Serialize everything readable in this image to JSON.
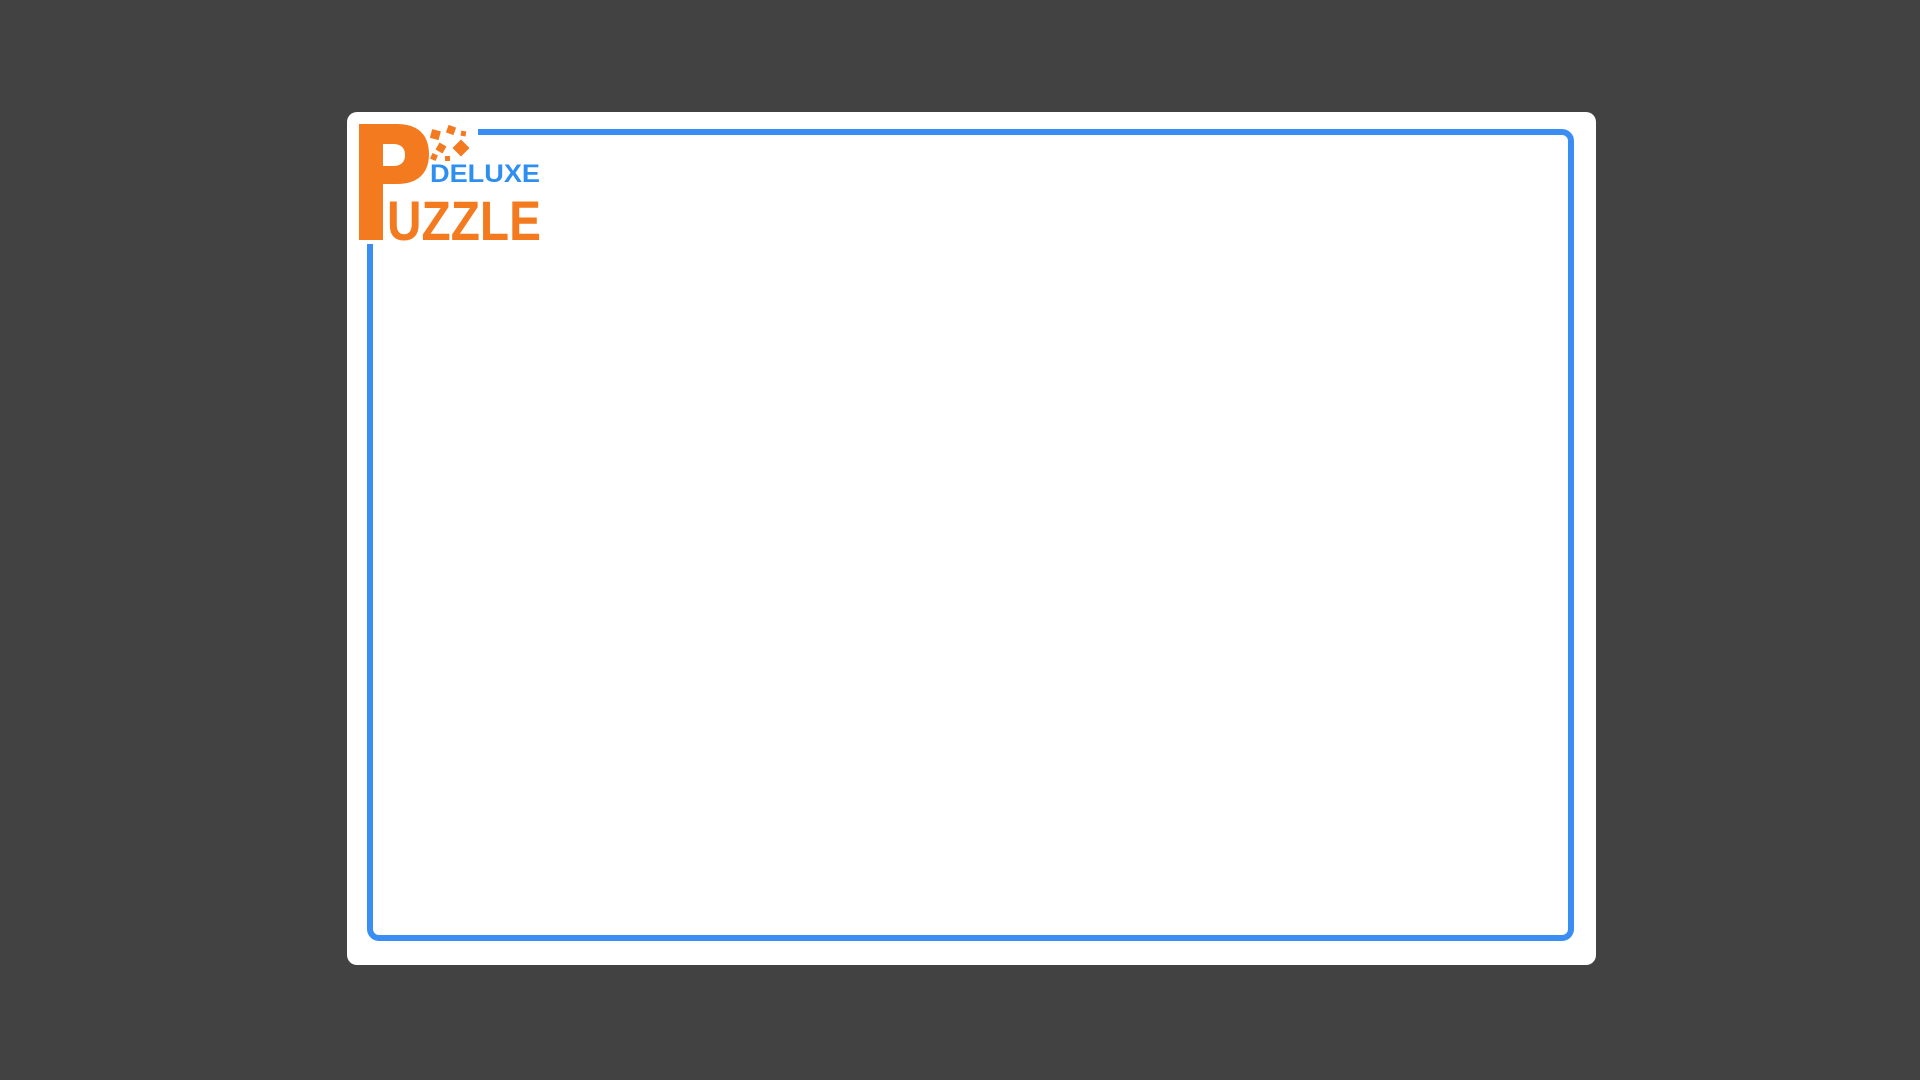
{
  "logo": {
    "word_top": "DELUXE",
    "word_main": "PUZZLE",
    "colors": {
      "orange": "#f47a20",
      "blue": "#2e8ff0"
    }
  },
  "board": {
    "frame_color": "#3a8ef3",
    "background": "#ffffff"
  },
  "page": {
    "backdrop_color": "#424242"
  }
}
